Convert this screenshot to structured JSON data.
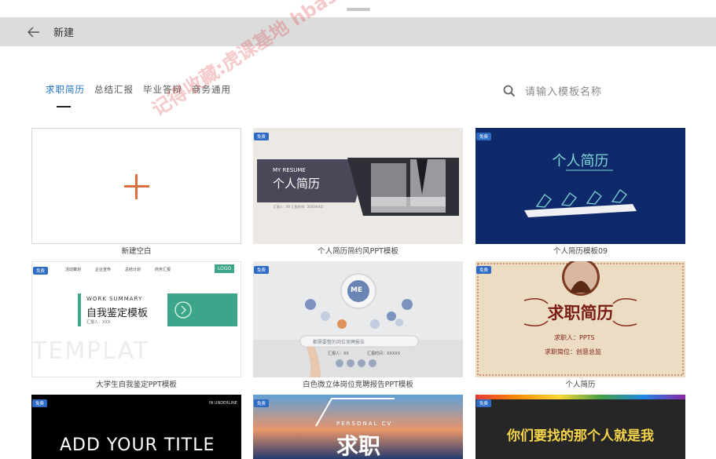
{
  "header": {
    "title": "新建"
  },
  "tabs": [
    {
      "label": "求职简历",
      "active": true
    },
    {
      "label": "总结汇报",
      "active": false
    },
    {
      "label": "毕业答辩",
      "active": false
    },
    {
      "label": "商务通用",
      "active": false
    }
  ],
  "search": {
    "placeholder": "请输入模板名称"
  },
  "watermark": "记得收藏:虎课基地 hbase.com",
  "badge_label": "免费",
  "templates": [
    {
      "caption": "新建空白"
    },
    {
      "caption": "个人简历简约风PPT模板",
      "subtitle": "MY RESUME",
      "title": "个人简历"
    },
    {
      "caption": "个人简历模板09",
      "title": "个人简历"
    },
    {
      "caption": "大学生自我鉴定PPT模板",
      "nav": [
        "活动策划",
        "企业宣传",
        "总结计划",
        "商务汇报"
      ],
      "logo": "LOGO",
      "subtitle": "WORK SUMMARY",
      "title": "自我鉴定模板",
      "meta": "汇报人：XXX",
      "bg_text": "TEMPLAT"
    },
    {
      "caption": "白色微立体岗位竞聘报告PPT模板",
      "center": "ME",
      "title": "都需要整的岗位竞聘报告",
      "meta1": "汇报人：XX",
      "meta2": "汇报时间：XXXXX"
    },
    {
      "caption": "个人简历",
      "title": "求职简历",
      "sub1": "求职人：PPTS",
      "sub2": "求职简位：创意总监"
    },
    {
      "caption": "",
      "corner": "IN UNDERLINE",
      "title": "ADD YOUR TITLE"
    },
    {
      "caption": "",
      "subtitle": "PERSONAL CV",
      "title": "求职"
    },
    {
      "caption": "",
      "title": "你们要找的那个人就是我"
    }
  ],
  "colors": {
    "accent": "#1e6fcc",
    "plus": "#d9713a",
    "badge": "#2e6bc4",
    "topbar": "#dcdcdc"
  }
}
